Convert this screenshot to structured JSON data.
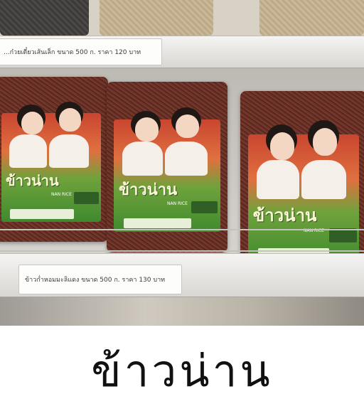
{
  "photo": {
    "description_free": true,
    "top_price_tag": "...ก๋วยเตี๋ยวเส้นเล็ก ขนาด 500 ก. ราคา 120 บาท",
    "bottom_price_tag": "ข้าวก่ำหอมมะลิแดง ขนาด 500 ก. ราคา 130 บาท",
    "pack_logo": "ข้าวน่าน",
    "pack_sub": "NAN RICE"
  },
  "caption": {
    "text": "ข้าวน่าน"
  }
}
